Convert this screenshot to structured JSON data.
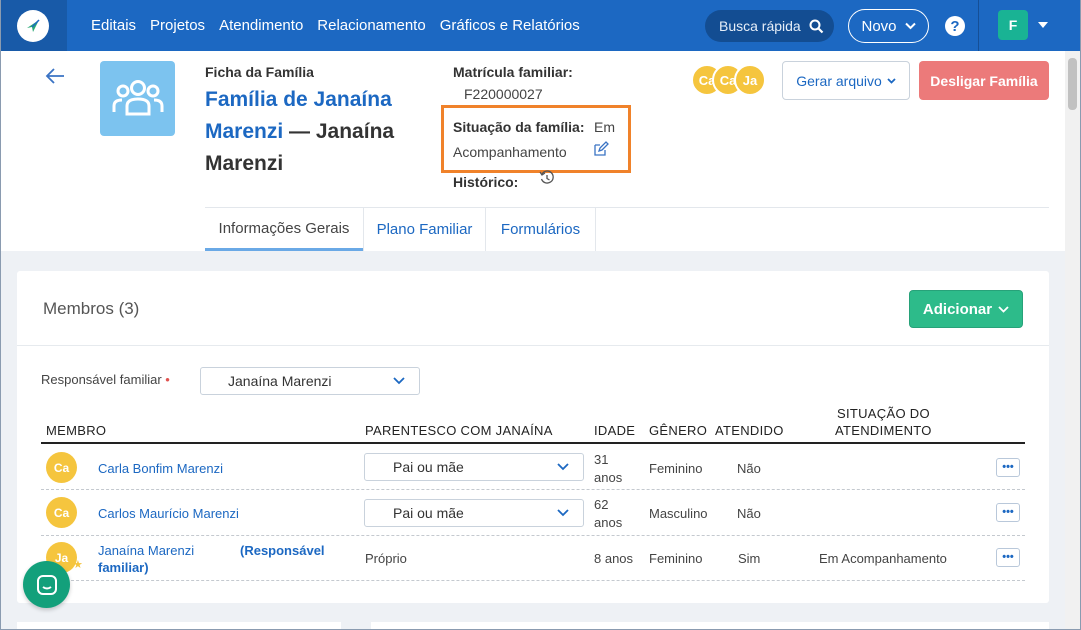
{
  "nav": {
    "items": [
      "Editais",
      "Projetos",
      "Atendimento",
      "Relacionamento",
      "Gráficos e Relatórios"
    ],
    "search_placeholder": "Busca rápida",
    "novo_label": "Novo",
    "help_label": "?",
    "user_initial": "F"
  },
  "header": {
    "ficha_label": "Ficha da Família",
    "family_link": "Família de Janaína Marenzi",
    "family_suffix": "— Janaína Marenzi",
    "matricula_label": "Matrícula familiar:",
    "matricula_value": "F220000027",
    "situacao_label": "Situação da família:",
    "situacao_value_1": "Em",
    "situacao_value_2": "Acompanhamento",
    "historico_label": "Histórico:",
    "avatars": [
      "Ca",
      "Ca",
      "Ja"
    ],
    "gerar_label": "Gerar arquivo",
    "desligar_label": "Desligar Família"
  },
  "tabs": [
    "Informações Gerais",
    "Plano Familiar",
    "Formulários"
  ],
  "members": {
    "title": "Membros (3)",
    "add_label": "Adicionar",
    "responsavel_label": "Responsável familiar",
    "responsavel_value": "Janaína Marenzi",
    "columns": [
      "MEMBRO",
      "PARENTESCO COM JANAÍNA",
      "IDADE",
      "GÊNERO",
      "ATENDIDO",
      "SITUAÇÃO DO",
      "ATENDIMENTO"
    ],
    "rows": [
      {
        "initials": "Ca",
        "name": "Carla Bonfim Marenzi",
        "parentesco": "Pai ou mãe",
        "idade_1": "31",
        "idade_2": "anos",
        "genero": "Feminino",
        "atendido": "Não",
        "situacao": ""
      },
      {
        "initials": "Ca",
        "name": "Carlos Maurício Marenzi",
        "parentesco": "Pai ou mãe",
        "idade_1": "62",
        "idade_2": "anos",
        "genero": "Masculino",
        "atendido": "Não",
        "situacao": ""
      },
      {
        "initials": "Ja",
        "name": "Janaína Marenzi",
        "responsavel_tag_1": "(Responsável",
        "responsavel_tag_2": "familiar)",
        "parentesco": "Próprio",
        "idade_1": "8 anos",
        "genero": "Feminino",
        "atendido": "Sim",
        "situacao": "Em Acompanhamento"
      }
    ],
    "more_label": "•••"
  },
  "colors": {
    "primary": "#1c68c2",
    "danger": "#ec7a7a",
    "success": "#2dbb8a",
    "highlight": "#f0822a",
    "avatar": "#f5c53e"
  }
}
